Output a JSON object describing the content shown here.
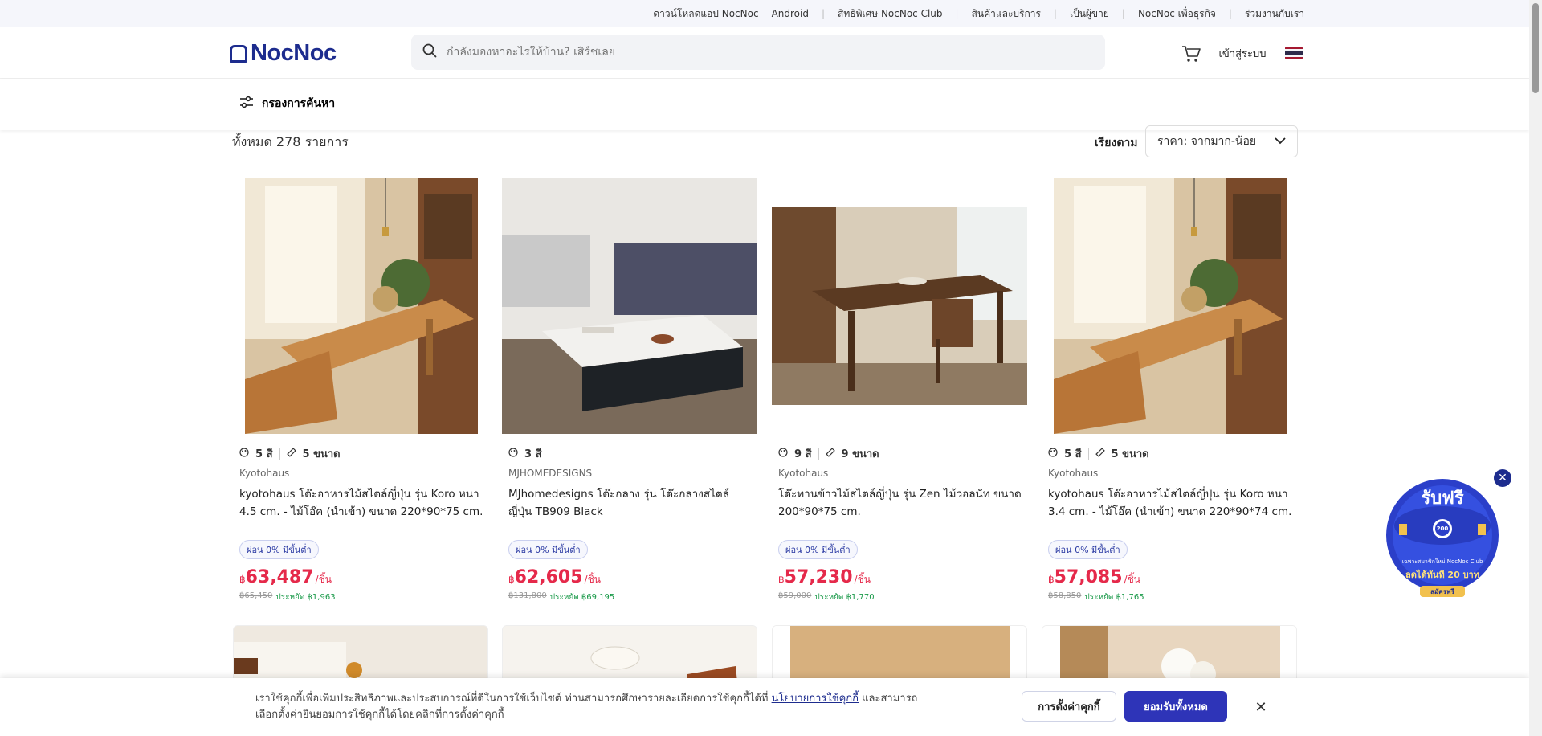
{
  "topbar": {
    "items": [
      "ดาวน์โหลดแอป NocNoc",
      "Android",
      "สิทธิพิเศษ NocNoc Club",
      "สินค้าและบริการ",
      "เป็นผู้ขาย",
      "NocNoc เพื่อธุรกิจ",
      "ร่วมงานกับเรา"
    ]
  },
  "header": {
    "logo": "NocNoc",
    "search_placeholder": "กำลังมองหาอะไรให้บ้าน? เสิร์ชเลย",
    "login_label": "เข้าสู่ระบบ"
  },
  "filter": {
    "label": "กรองการค้นหา"
  },
  "results": {
    "count_label": "ทั้งหมด 278 รายการ",
    "sort_label": "เรียงตาม",
    "sort_value": "ราคา: จากมาก-น้อย"
  },
  "products": [
    {
      "colors": "5 สี",
      "sizes": "5 ขนาด",
      "brand": "Kyotohaus",
      "title": "kyotohaus โต๊ะอาหารไม้สไตล์ญี่ปุ่น รุ่น Koro หนา 4.5 cm. - ไม้โอ๊ค (นำเข้า) ขนาด 220*90*75 cm.",
      "badge": "ผ่อน 0% มีขั้นต่ำ",
      "currency": "฿",
      "price": "63,487",
      "unit": "/ชิ้น",
      "old_price": "฿65,450",
      "save": "ประหยัด ฿1,963"
    },
    {
      "colors": "3 สี",
      "sizes": "",
      "brand": "MJHOMEDESIGNS",
      "title": "MJhomedesigns โต๊ะกลาง รุ่น โต๊ะกลางสไตล์ญี่ปุ่น TB909 Black",
      "badge": "ผ่อน 0% มีขั้นต่ำ",
      "currency": "฿",
      "price": "62,605",
      "unit": "/ชิ้น",
      "old_price": "฿131,800",
      "save": "ประหยัด ฿69,195"
    },
    {
      "colors": "9 สี",
      "sizes": "9 ขนาด",
      "brand": "Kyotohaus",
      "title": "โต๊ะทานข้าวไม้สไตล์ญี่ปุ่น รุ่น Zen ไม้วอลนัท ขนาด 200*90*75 cm.",
      "badge": "ผ่อน 0% มีขั้นต่ำ",
      "currency": "฿",
      "price": "57,230",
      "unit": "/ชิ้น",
      "old_price": "฿59,000",
      "save": "ประหยัด ฿1,770"
    },
    {
      "colors": "5 สี",
      "sizes": "5 ขนาด",
      "brand": "Kyotohaus",
      "title": "kyotohaus โต๊ะอาหารไม้สไตล์ญี่ปุ่น รุ่น Koro หนา 3.4 cm. - ไม้โอ๊ค (นำเข้า) ขนาด 220*90*74 cm.",
      "badge": "ผ่อน 0% มีขั้นต่ำ",
      "currency": "฿",
      "price": "57,085",
      "unit": "/ชิ้น",
      "old_price": "฿58,850",
      "save": "ประหยัด ฿1,765"
    }
  ],
  "promo": {
    "headline": "รับฟรี",
    "badge_value": "200",
    "line1": "เฉพาะสมาชิกใหม่ NocNoc Club",
    "line2": "ลดได้ทันที 20 บาท",
    "cta": "สมัครฟรี"
  },
  "cookie": {
    "text_before": "เราใช้คุกกี้เพื่อเพิ่มประสิทธิภาพและประสบการณ์ที่ดีในการใช้เว็บไซต์ ท่านสามารถศึกษารายละเอียดการใช้คุกกี้ได้ที่ ",
    "link": "นโยบายการใช้คุกกี้",
    "text_after": " และสามารถเลือกตั้งค่ายินยอมการใช้คุกกี้ได้โดยคลิกที่การตั้งค่าคุกกี้",
    "settings_label": "การตั้งค่าคุกกี้",
    "accept_label": "ยอมรับทั้งหมด"
  },
  "colors": {
    "brand": "#1d2c8e",
    "price": "#e5294a",
    "accept": "#2e34b8",
    "save": "#1b9a4a"
  }
}
